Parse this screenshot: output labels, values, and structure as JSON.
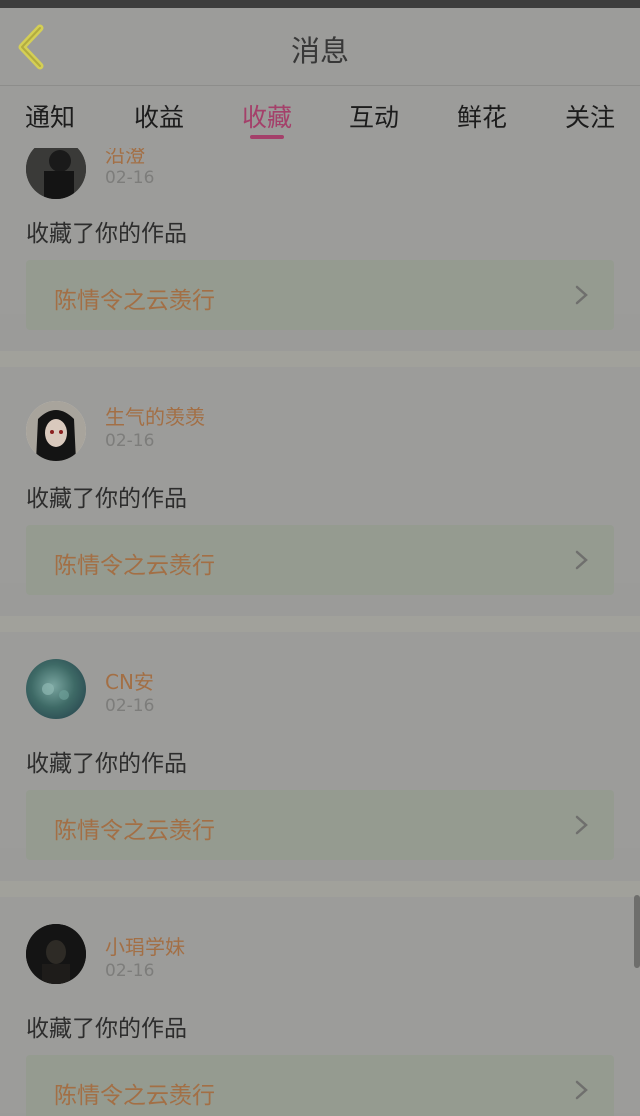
{
  "header": {
    "title": "消息"
  },
  "tabs": [
    {
      "label": "通知"
    },
    {
      "label": "收益"
    },
    {
      "label": "收藏"
    },
    {
      "label": "互动"
    },
    {
      "label": "鲜花"
    },
    {
      "label": "关注"
    }
  ],
  "active_tab": "收藏",
  "messages": [
    {
      "user": "沿澄",
      "date": "02-16",
      "action": "收藏了你的作品",
      "work": "陈情令之云羡行"
    },
    {
      "user": "生气的羡羡",
      "date": "02-16",
      "action": "收藏了你的作品",
      "work": "陈情令之云羡行"
    },
    {
      "user": "CN安",
      "date": "02-16",
      "action": "收藏了你的作品",
      "work": "陈情令之云羡行"
    },
    {
      "user": "小琄学妹",
      "date": "02-16",
      "action": "收藏了你的作品",
      "work": "陈情令之云羡行"
    }
  ],
  "colors": {
    "accent": "#a4406a",
    "username": "#a36f45",
    "work_card": "#959b90"
  }
}
